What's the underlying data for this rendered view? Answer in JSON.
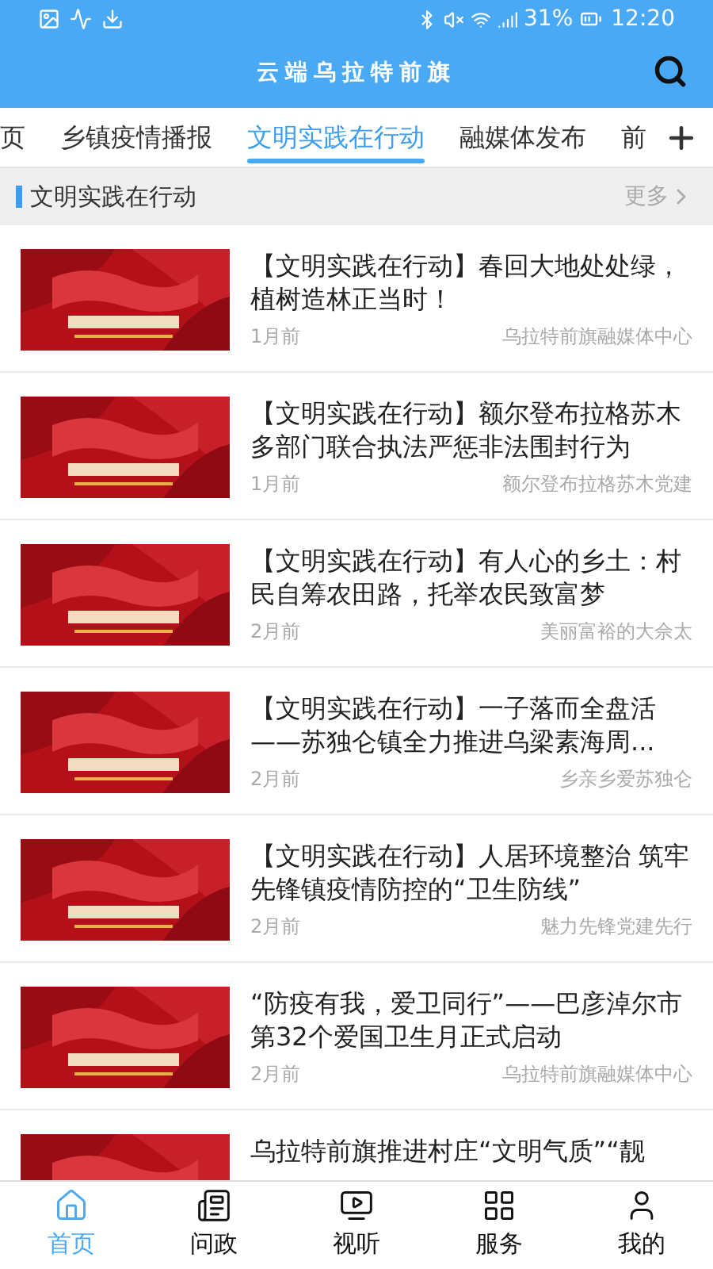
{
  "status_bar": {
    "battery": "31%",
    "time": "12:20"
  },
  "header": {
    "title": "云端乌拉特前旗"
  },
  "tabs": [
    {
      "label": "页",
      "selected": false
    },
    {
      "label": "乡镇疫情播报",
      "selected": false
    },
    {
      "label": "文明实践在行动",
      "selected": true
    },
    {
      "label": "融媒体发布",
      "selected": false
    },
    {
      "label": "前",
      "selected": false
    }
  ],
  "section": {
    "title": "文明实践在行动",
    "more": "更多"
  },
  "articles": [
    {
      "title": "【文明实践在行动】春回大地处处绿，植树造林正当时！",
      "time": "1月前",
      "source": "乌拉特前旗融媒体中心"
    },
    {
      "title": "【文明实践在行动】额尔登布拉格苏木多部门联合执法严惩非法围封行为",
      "time": "1月前",
      "source": "额尔登布拉格苏木党建"
    },
    {
      "title": "【文明实践在行动】有人心的乡土：村民自筹农田路，托举农民致富梦",
      "time": "2月前",
      "source": "美丽富裕的大佘太"
    },
    {
      "title": "【文明实践在行动】一子落而全盘活——苏独仑镇全力推进乌梁素海周...",
      "time": "2月前",
      "source": "乡亲乡爱苏独仑"
    },
    {
      "title": "【文明实践在行动】人居环境整治 筑牢先锋镇疫情防控的“卫生防线”",
      "time": "2月前",
      "source": "魅力先锋党建先行"
    },
    {
      "title": "“防疫有我，爱卫同行”——巴彦淖尔市第32个爱国卫生月正式启动",
      "time": "2月前",
      "source": "乌拉特前旗融媒体中心"
    },
    {
      "title": "乌拉特前旗推进村庄“文明气质”“靓"
    }
  ],
  "bottom_nav": [
    {
      "label": "首页",
      "selected": true
    },
    {
      "label": "问政",
      "selected": false
    },
    {
      "label": "视听",
      "selected": false
    },
    {
      "label": "服务",
      "selected": false
    },
    {
      "label": "我的",
      "selected": false
    }
  ]
}
